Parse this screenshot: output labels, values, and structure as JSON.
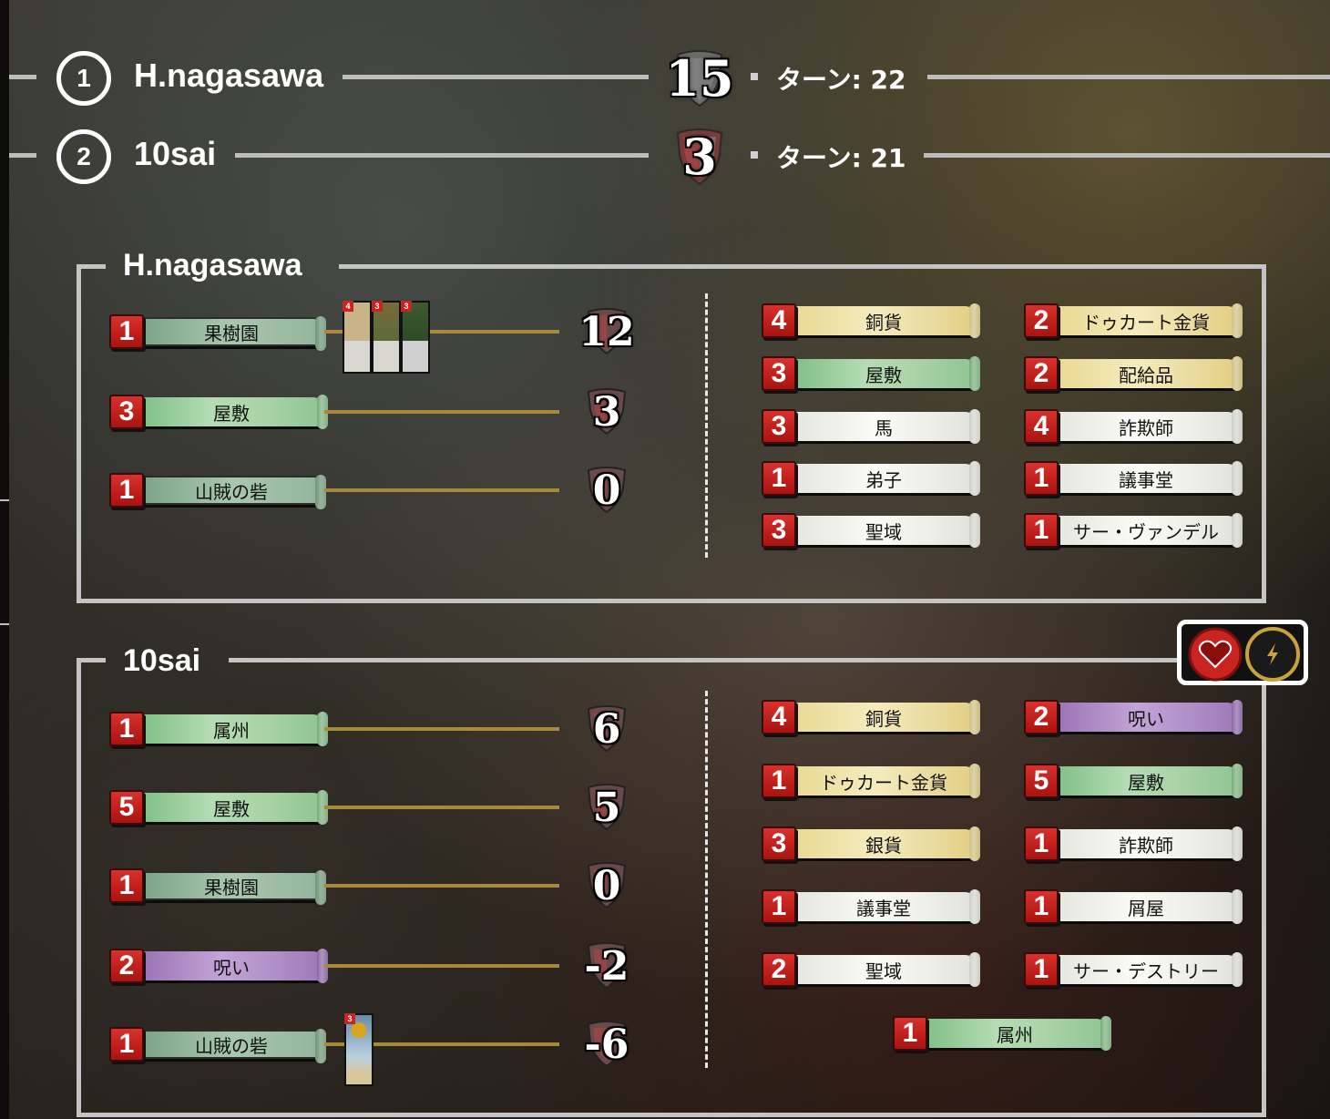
{
  "ranking": [
    {
      "rank": "1",
      "name": "H.nagasawa",
      "vp": "15",
      "turn": "ターン: 22"
    },
    {
      "rank": "2",
      "name": "10sai",
      "vp": "3",
      "turn": "ターン: 21"
    }
  ],
  "players": [
    {
      "name": "H.nagasawa",
      "vp_rows": [
        {
          "count": "1",
          "card": "果樹園",
          "type": "gray-green",
          "vp": "12"
        },
        {
          "count": "3",
          "card": "屋敷",
          "type": "green",
          "vp": "3"
        },
        {
          "count": "1",
          "card": "山賊の砦",
          "type": "gray-green",
          "vp": "0"
        }
      ],
      "thumb_costs": [
        "4",
        "3",
        "3"
      ],
      "deck": [
        {
          "count": "4",
          "card": "銅貨",
          "type": "gold"
        },
        {
          "count": "2",
          "card": "ドゥカート金貨",
          "type": "gold"
        },
        {
          "count": "3",
          "card": "屋敷",
          "type": "green"
        },
        {
          "count": "2",
          "card": "配給品",
          "type": "gold"
        },
        {
          "count": "3",
          "card": "馬",
          "type": "white"
        },
        {
          "count": "4",
          "card": "詐欺師",
          "type": "white"
        },
        {
          "count": "1",
          "card": "弟子",
          "type": "white"
        },
        {
          "count": "1",
          "card": "議事堂",
          "type": "white"
        },
        {
          "count": "3",
          "card": "聖域",
          "type": "white"
        },
        {
          "count": "1",
          "card": "サー・ヴァンデル",
          "type": "white"
        }
      ]
    },
    {
      "name": "10sai",
      "vp_rows": [
        {
          "count": "1",
          "card": "属州",
          "type": "green",
          "vp": "6"
        },
        {
          "count": "5",
          "card": "屋敷",
          "type": "green",
          "vp": "5"
        },
        {
          "count": "1",
          "card": "果樹園",
          "type": "gray-green",
          "vp": "0"
        },
        {
          "count": "2",
          "card": "呪い",
          "type": "purple",
          "vp": "-2"
        },
        {
          "count": "1",
          "card": "山賊の砦",
          "type": "gray-green",
          "vp": "-6"
        }
      ],
      "thumb_costs": [
        "3"
      ],
      "deck": [
        {
          "count": "4",
          "card": "銅貨",
          "type": "gold"
        },
        {
          "count": "2",
          "card": "呪い",
          "type": "purple"
        },
        {
          "count": "1",
          "card": "ドゥカート金貨",
          "type": "gold"
        },
        {
          "count": "5",
          "card": "屋敷",
          "type": "green"
        },
        {
          "count": "3",
          "card": "銀貨",
          "type": "gold"
        },
        {
          "count": "1",
          "card": "詐欺師",
          "type": "white"
        },
        {
          "count": "1",
          "card": "議事堂",
          "type": "white"
        },
        {
          "count": "1",
          "card": "屑屋",
          "type": "white"
        },
        {
          "count": "2",
          "card": "聖域",
          "type": "white"
        },
        {
          "count": "1",
          "card": "サー・デストリー",
          "type": "white"
        },
        {
          "count": "1",
          "card": "属州",
          "type": "green"
        }
      ]
    }
  ],
  "icons": {
    "like": "heart-icon",
    "quick": "lightning-icon"
  },
  "colors": {
    "accent_red": "#c9241f",
    "vp_line": "#a8893c",
    "frame": "#c4c4c4"
  }
}
